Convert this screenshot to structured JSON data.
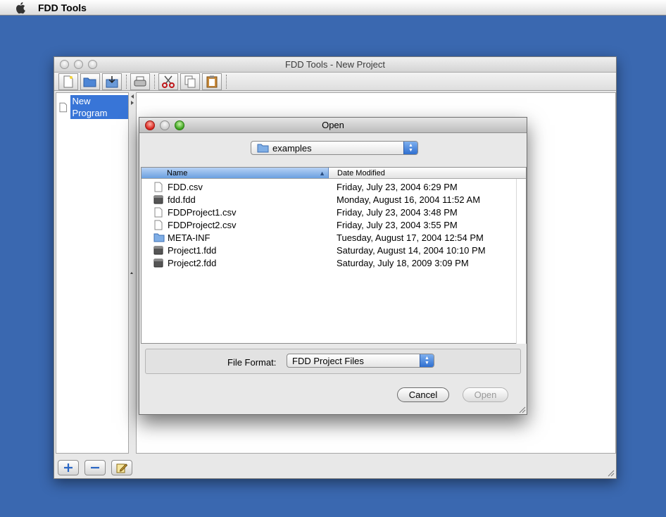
{
  "menubar": {
    "app_name": "FDD Tools"
  },
  "main_window": {
    "title": "FDD Tools - New Project",
    "tree": {
      "selected_item": "New Program"
    }
  },
  "dialog": {
    "title": "Open",
    "folder_popup": {
      "value": "examples"
    },
    "columns": {
      "name": "Name",
      "date": "Date Modified"
    },
    "files": [
      {
        "name": "FDD.csv",
        "date": "Friday, July 23, 2004 6:29 PM",
        "icon": "document-icon"
      },
      {
        "name": "fdd.fdd",
        "date": "Monday, August 16, 2004 11:52 AM",
        "icon": "fdd-file-icon"
      },
      {
        "name": "FDDProject1.csv",
        "date": "Friday, July 23, 2004 3:48 PM",
        "icon": "document-icon"
      },
      {
        "name": "FDDProject2.csv",
        "date": "Friday, July 23, 2004 3:55 PM",
        "icon": "document-icon"
      },
      {
        "name": "META-INF",
        "date": "Tuesday, August 17, 2004 12:54 PM",
        "icon": "folder-icon"
      },
      {
        "name": "Project1.fdd",
        "date": "Saturday, August 14, 2004 10:10 PM",
        "icon": "fdd-file-icon"
      },
      {
        "name": "Project2.fdd",
        "date": "Saturday, July 18, 2009 3:09 PM",
        "icon": "fdd-file-icon"
      }
    ],
    "file_format": {
      "label": "File Format:",
      "value": "FDD Project Files"
    },
    "buttons": {
      "cancel": "Cancel",
      "open": "Open"
    }
  },
  "colors": {
    "desktop": "#3a68b0",
    "selection": "#3875d7",
    "popup_arrow": "#2f6fd0"
  }
}
